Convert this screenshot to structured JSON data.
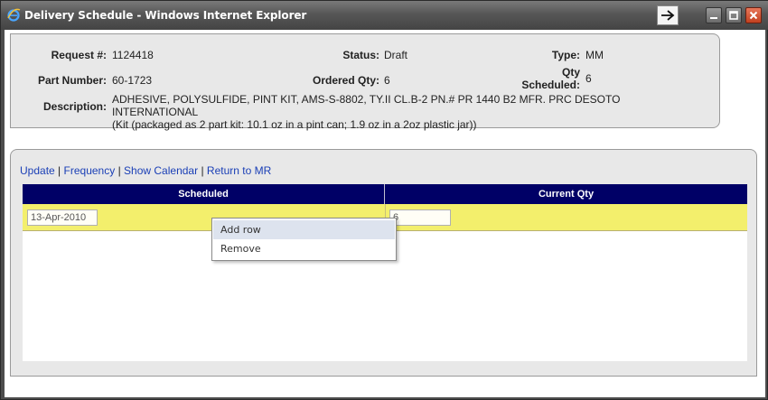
{
  "window": {
    "title": "Delivery Schedule - Windows Internet Explorer",
    "icons": {
      "app": "ie-icon",
      "forward": "arrow-right-icon",
      "minimize": "minimize-icon",
      "maximize": "maximize-icon",
      "close": "close-icon"
    }
  },
  "info": {
    "request_label": "Request #:",
    "request_value": "1124418",
    "status_label": "Status:",
    "status_value": "Draft",
    "type_label": "Type:",
    "type_value": "MM",
    "part_label": "Part Number:",
    "part_value": "60-1723",
    "ordered_label": "Ordered Qty:",
    "ordered_value": "6",
    "qty_sched_label_1": "Qty",
    "qty_sched_label_2": "Scheduled:",
    "qty_sched_value": "6",
    "desc_label": "Description:",
    "desc_line1": "ADHESIVE, POLYSULFIDE, PINT KIT, AMS-S-8802, TY.II CL.B-2 PN.# PR 1440 B2 MFR. PRC DESOTO INTERNATIONAL",
    "desc_line2": "(Kit (packaged as 2 part kit: 10.1 oz in a pint can; 1.9 oz in a 2oz plastic jar))"
  },
  "links": {
    "update": "Update",
    "frequency": "Frequency",
    "calendar": "Show Calendar",
    "return": "Return to MR",
    "sep": "|"
  },
  "grid": {
    "columns": [
      "Scheduled",
      "Current Qty"
    ],
    "rows": [
      {
        "scheduled": "13-Apr-2010",
        "qty": "6"
      }
    ]
  },
  "context_menu": {
    "items": [
      "Add row",
      "Remove"
    ]
  },
  "colors": {
    "grid_header": "#000066",
    "row_highlight": "#f3ef6c",
    "link": "#1a3fb6"
  }
}
